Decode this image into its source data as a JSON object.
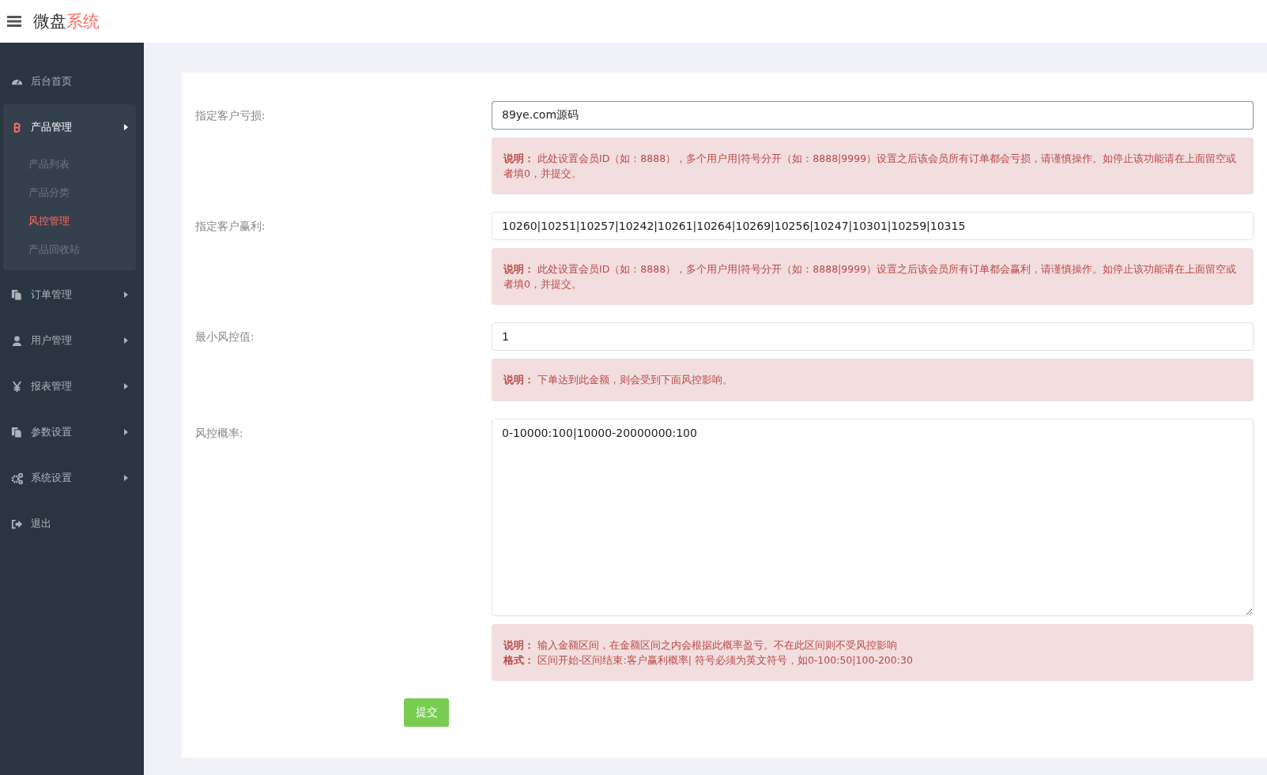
{
  "header": {
    "logo_dark": "微盘",
    "logo_accent": "系统"
  },
  "sidebar": {
    "items": [
      {
        "kind": "dashboard",
        "label": "后台首页",
        "has_arrow": false,
        "expanded": false
      },
      {
        "kind": "bitcoin",
        "label": "产品管理",
        "has_arrow": true,
        "expanded": true,
        "children": [
          {
            "label": "产品列表",
            "selected": false
          },
          {
            "label": "产品分类",
            "selected": false
          },
          {
            "label": "风控管理",
            "selected": true
          },
          {
            "label": "产品回收站",
            "selected": false
          }
        ]
      },
      {
        "kind": "files",
        "label": "订单管理",
        "has_arrow": true,
        "expanded": false
      },
      {
        "kind": "user",
        "label": "用户管理",
        "has_arrow": true,
        "expanded": false
      },
      {
        "kind": "yen",
        "label": "报表管理",
        "has_arrow": true,
        "expanded": false
      },
      {
        "kind": "files",
        "label": "参数设置",
        "has_arrow": true,
        "expanded": false
      },
      {
        "kind": "gears",
        "label": "系统设置",
        "has_arrow": true,
        "expanded": false
      },
      {
        "kind": "signout",
        "label": "退出",
        "has_arrow": false,
        "expanded": false
      }
    ]
  },
  "form": {
    "fields": [
      {
        "label": "指定客户亏损:",
        "kind": "input",
        "value": "89ye.com源码",
        "focused": true,
        "note": [
          "**说明：** 此处设置会员ID（如：8888），多个用户用|符号分开（如：8888|9999）设置之后该会员所有订单都会亏损，请谨慎操作。如停止该功能请在上面留空或者填0，并提交。"
        ]
      },
      {
        "label": "指定客户赢利:",
        "kind": "input",
        "value": "10260|10251|10257|10242|10261|10264|10269|10256|10247|10301|10259|10315",
        "focused": false,
        "note": [
          "**说明：** 此处设置会员ID（如：8888），多个用户用|符号分开（如：8888|9999）设置之后该会员所有订单都会赢利，请谨慎操作。如停止该功能请在上面留空或者填0，并提交。"
        ]
      },
      {
        "label": "最小风控值:",
        "kind": "input",
        "value": "1",
        "focused": false,
        "note": [
          "**说明：** 下单达到此金额，则会受到下面风控影响。"
        ]
      },
      {
        "label": "风控概率:",
        "kind": "textarea",
        "value": "0-10000:100|10000-20000000:100",
        "focused": false,
        "note": [
          "**说明：** 输入金额区间，在金额区间之内会根据此概率盈亏。不在此区间则不受风控影响",
          "**格式：** 区间开始-区间结束:客户赢利概率|        符号必须为英文符号，如0-100:50|100-200:30"
        ]
      }
    ],
    "submit": "提交"
  }
}
